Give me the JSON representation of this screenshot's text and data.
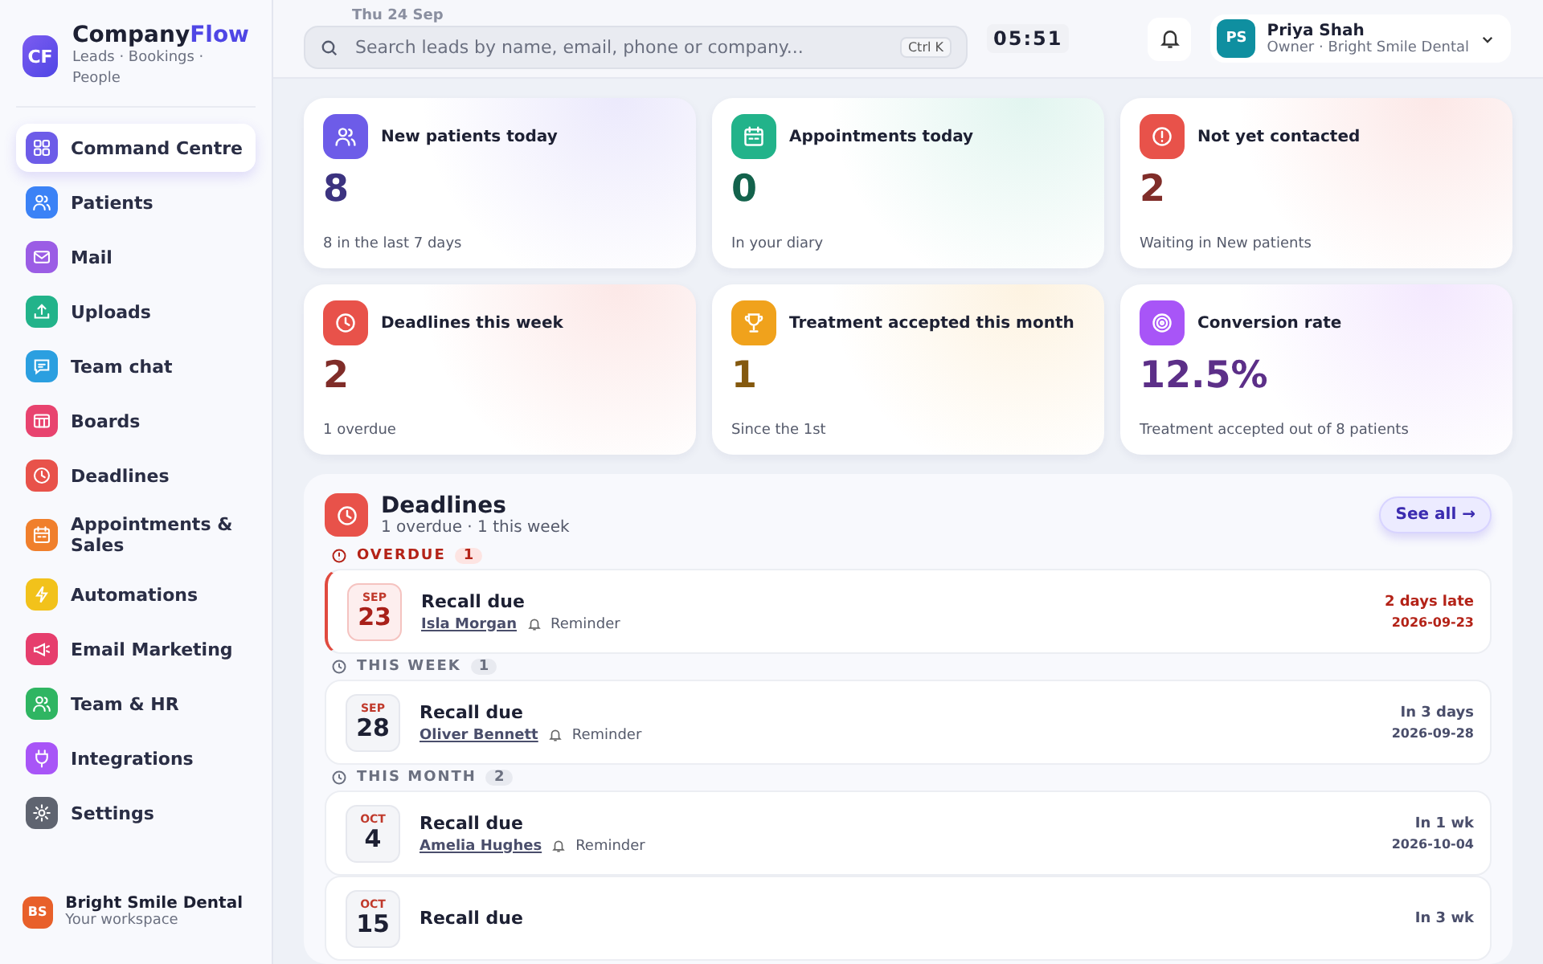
{
  "brand": {
    "initials": "CF",
    "name_part1": "Company",
    "name_part2": "Flow",
    "tagline": "Leads · Bookings · People"
  },
  "sidebar": {
    "items": [
      {
        "label": "Command Centre",
        "selected": true,
        "color": "#6d5ce8"
      },
      {
        "label": "Patients",
        "selected": false,
        "color": "#3b82f6"
      },
      {
        "label": "Mail",
        "selected": false,
        "color": "#9b5de5"
      },
      {
        "label": "Uploads",
        "selected": false,
        "color": "#22b38a"
      },
      {
        "label": "Team chat",
        "selected": false,
        "color": "#2b9fe0"
      },
      {
        "label": "Boards",
        "selected": false,
        "color": "#e8436f"
      },
      {
        "label": "Deadlines",
        "selected": false,
        "color": "#e8524a"
      },
      {
        "label": "Appointments & Sales",
        "selected": false,
        "color": "#f07f2c"
      },
      {
        "label": "Automations",
        "selected": false,
        "color": "#f2c21b"
      },
      {
        "label": "Email Marketing",
        "selected": false,
        "color": "#e63e6d"
      },
      {
        "label": "Team & HR",
        "selected": false,
        "color": "#2fb562"
      },
      {
        "label": "Integrations",
        "selected": false,
        "color": "#a855f7"
      },
      {
        "label": "Settings",
        "selected": false,
        "color": "#5f6470"
      }
    ],
    "workspace": {
      "initials": "BS",
      "name": "Bright Smile Dental",
      "subtitle": "Your workspace"
    }
  },
  "topbar": {
    "date": "Thu 24 Sep",
    "search": {
      "placeholder": "Search leads by name, email, phone or company...",
      "shortcut": "Ctrl K"
    },
    "clock": "05:51",
    "user": {
      "initials": "PS",
      "name": "Priya Shah",
      "role": "Owner · Bright Smile Dental"
    }
  },
  "stats": [
    {
      "title": "New patients today",
      "value": "8",
      "note": "8 in the last 7 days",
      "color": "#6d5ce8"
    },
    {
      "title": "Appointments today",
      "value": "0",
      "note": "In your diary",
      "color": "#22b38a"
    },
    {
      "title": "Not yet contacted",
      "value": "2",
      "note": "Waiting in New patients",
      "color": "#e8524a"
    },
    {
      "title": "Deadlines this week",
      "value": "2",
      "note": "1 overdue",
      "color": "#e8524a"
    },
    {
      "title": "Treatment accepted this month",
      "value": "1",
      "note": "Since the 1st",
      "color": "#f0a21c"
    },
    {
      "title": "Conversion rate",
      "value": "12.5%",
      "note": "Treatment accepted out of 8 patients",
      "color": "#a855f7"
    }
  ],
  "deadlines": {
    "title": "Deadlines",
    "subtitle": "1 overdue · 1 this week",
    "see_all": "See all",
    "arrow": "→",
    "groups": [
      {
        "label": "OVERDUE",
        "count": "1",
        "kind": "overdue",
        "items": [
          {
            "month": "SEP",
            "day": "23",
            "title": "Recall due",
            "person": "Isla Morgan",
            "tag": "Reminder",
            "relative": "2 days late",
            "date": "2026-09-23"
          }
        ]
      },
      {
        "label": "THIS WEEK",
        "count": "1",
        "kind": "upcoming",
        "items": [
          {
            "month": "SEP",
            "day": "28",
            "title": "Recall due",
            "person": "Oliver Bennett",
            "tag": "Reminder",
            "relative": "In 3 days",
            "date": "2026-09-28"
          }
        ]
      },
      {
        "label": "THIS MONTH",
        "count": "2",
        "kind": "upcoming",
        "items": [
          {
            "month": "OCT",
            "day": "4",
            "title": "Recall due",
            "person": "Amelia Hughes",
            "tag": "Reminder",
            "relative": "In 1 wk",
            "date": "2026-10-04"
          },
          {
            "month": "OCT",
            "day": "15",
            "title": "Recall due",
            "relative": "In 3 wk"
          }
        ]
      }
    ]
  }
}
